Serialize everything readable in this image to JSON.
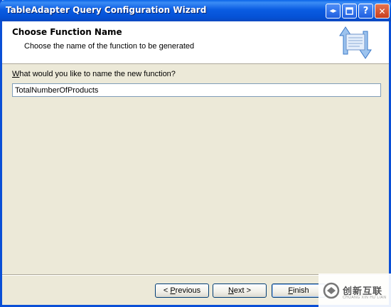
{
  "window": {
    "title": "TableAdapter Query Configuration Wizard",
    "controls": {
      "help_icon": "resize-arrows-icon",
      "restore_icon": "restore-icon",
      "question": "?",
      "close": "✕"
    }
  },
  "header": {
    "title": "Choose Function Name",
    "subtitle": "Choose the name of the function to be generated"
  },
  "form": {
    "label_prefix": "W",
    "label_rest": "hat would you like to name the new function?",
    "function_name_value": "TotalNumberOfProducts"
  },
  "buttons": {
    "previous_prefix": "< ",
    "previous_key": "P",
    "previous_rest": "revious",
    "next_key": "N",
    "next_rest": "ext >",
    "finish_key": "F",
    "finish_rest": "inish"
  },
  "watermark": {
    "text": "创新互联",
    "sub": "CHUANG XIN HU LIAN"
  },
  "colors": {
    "titlebar": "#0a5ce2",
    "window_bg": "#ece9d8",
    "button_border": "#003c74"
  }
}
